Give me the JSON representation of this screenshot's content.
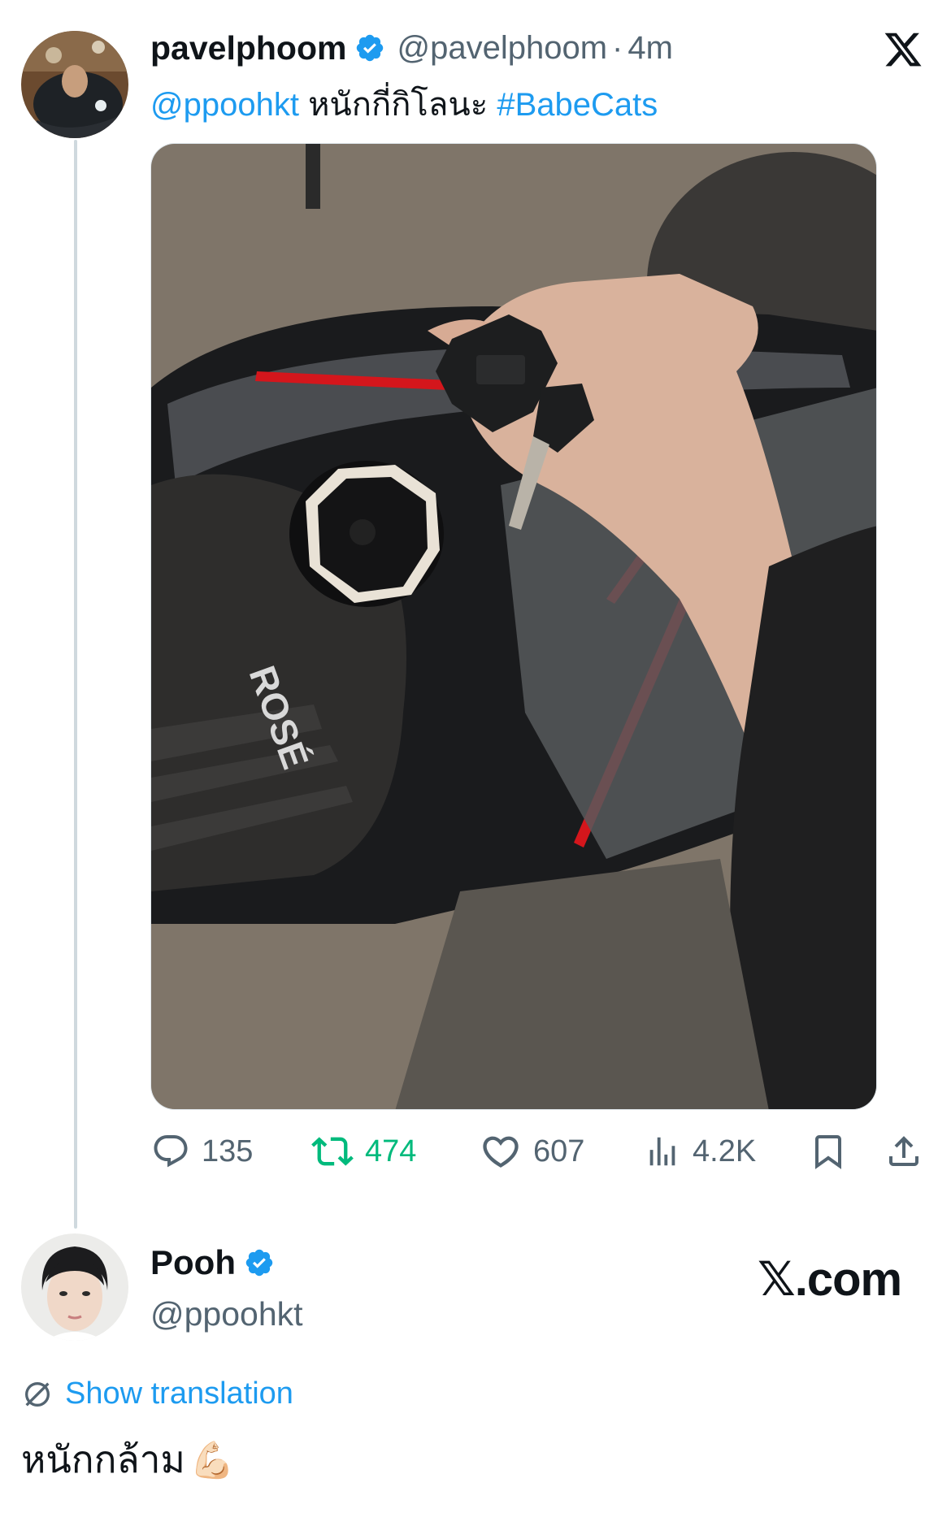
{
  "tweet1": {
    "name": "pavelphoom",
    "handle": "@pavelphoom",
    "separator": "·",
    "time": "4m",
    "mention": "@ppoohkt",
    "text": " หนักกี่กิโลนะ ",
    "hashtag": "#BabeCats",
    "photo_text": "ROSÉ",
    "actions": {
      "replies": "135",
      "retweets": "474",
      "likes": "607",
      "views": "4.2K"
    }
  },
  "tweet2": {
    "name": "Pooh",
    "handle": "@ppoohkt",
    "show_translation": "Show translation",
    "text": "หนักกล้าม",
    "emoji": "💪🏻"
  },
  "branding": {
    "site": "𝕏.com"
  },
  "colors": {
    "link": "#1d9bf0",
    "verified": "#1d9bf0",
    "retweet": "#00ba7c",
    "muted": "#536471",
    "thread_line": "#cfd9de"
  },
  "icons": [
    "verified-badge-icon",
    "x-logo-icon",
    "reply-icon",
    "retweet-icon",
    "like-icon",
    "views-icon",
    "bookmark-icon",
    "share-icon",
    "translate-icon"
  ]
}
